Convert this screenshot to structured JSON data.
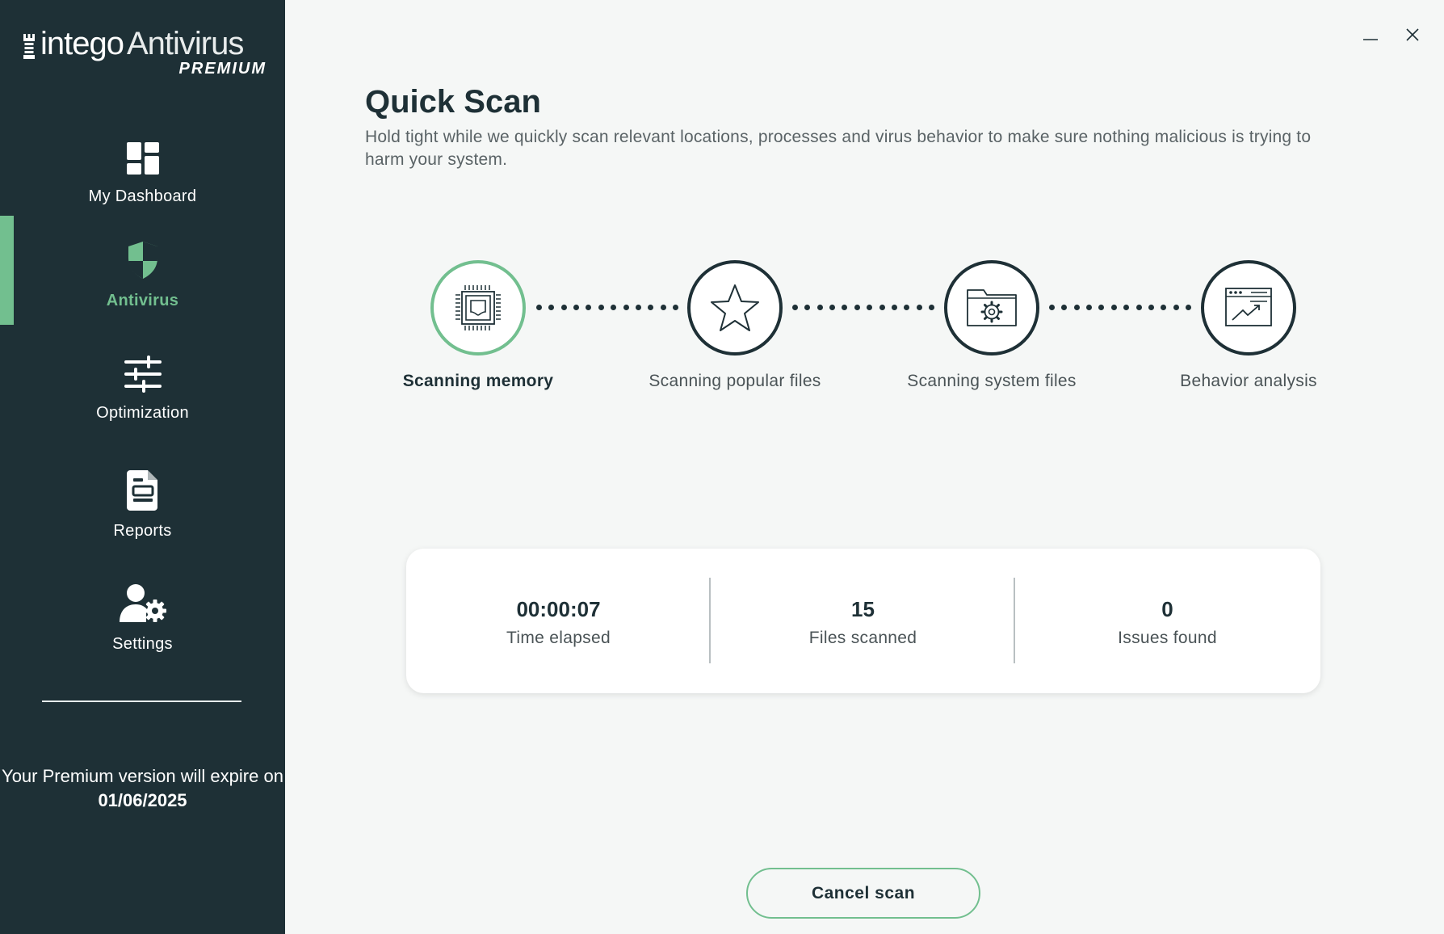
{
  "app": {
    "logo_brand": "intego",
    "logo_product": "Antivirus",
    "logo_tier": "PREMIUM"
  },
  "sidebar": {
    "items": [
      {
        "label": "My Dashboard",
        "icon": "dashboard-grid-icon",
        "active": false
      },
      {
        "label": "Antivirus",
        "icon": "shield-icon",
        "active": true
      },
      {
        "label": "Optimization",
        "icon": "sliders-icon",
        "active": false
      },
      {
        "label": "Reports",
        "icon": "document-icon",
        "active": false
      },
      {
        "label": "Settings",
        "icon": "user-gear-icon",
        "active": false
      }
    ],
    "expiry_prefix": "Your Premium version will expire on",
    "expiry_date": "01/06/2025"
  },
  "window": {
    "minimize_icon": "minimize-icon",
    "close_icon": "close-icon"
  },
  "main": {
    "title": "Quick Scan",
    "subtitle": "Hold tight while we quickly scan relevant locations, processes and virus behavior to make sure nothing malicious is trying to harm your system.",
    "steps": [
      {
        "label": "Scanning memory",
        "icon": "memory-chip-icon",
        "active": true
      },
      {
        "label": "Scanning popular files",
        "icon": "star-icon",
        "active": false
      },
      {
        "label": "Scanning system files",
        "icon": "system-folder-icon",
        "active": false
      },
      {
        "label": "Behavior analysis",
        "icon": "behavior-chart-icon",
        "active": false
      }
    ],
    "stats": [
      {
        "value": "00:00:07",
        "label": "Time elapsed"
      },
      {
        "value": "15",
        "label": "Files scanned"
      },
      {
        "value": "0",
        "label": "Issues found"
      }
    ],
    "cancel_label": "Cancel scan"
  },
  "colors": {
    "sidebar_bg": "#1e3036",
    "accent_green": "#72bf8f",
    "page_bg": "#f5f7f6",
    "text_dark": "#1e3036"
  }
}
